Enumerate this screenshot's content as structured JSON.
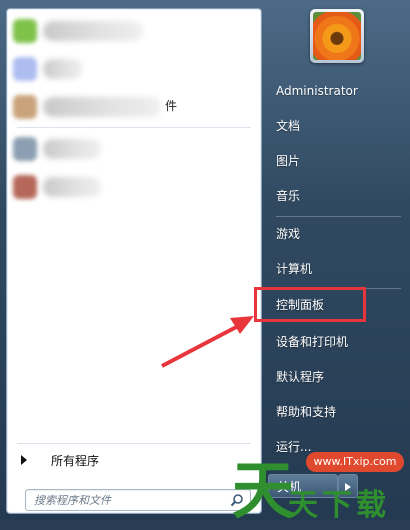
{
  "colors": {
    "highlight_border": "#e8343b",
    "arrow": "#e8343b",
    "pane_bg": "#ffffff",
    "right_pane_bg": "#304961",
    "watermark_green": "#2f8f2f",
    "watermark_badge": "#e1492e"
  },
  "left_pane": {
    "trunc_char": "件",
    "all_programs": "所有程序",
    "search_placeholder": "搜索程序和文件",
    "search_icon": "search-icon"
  },
  "right_pane": {
    "user": "Administrator",
    "items": [
      {
        "label": "文档"
      },
      {
        "label": "图片"
      },
      {
        "label": "音乐"
      },
      {
        "label": "游戏"
      },
      {
        "label": "计算机"
      },
      {
        "label": "控制面板"
      },
      {
        "label": "设备和打印机"
      },
      {
        "label": "默认程序"
      },
      {
        "label": "帮助和支持"
      },
      {
        "label": "运行..."
      }
    ],
    "shutdown": "关机"
  },
  "watermark": {
    "url": "www.ITxip.com",
    "big": "天",
    "small": "天下载"
  }
}
